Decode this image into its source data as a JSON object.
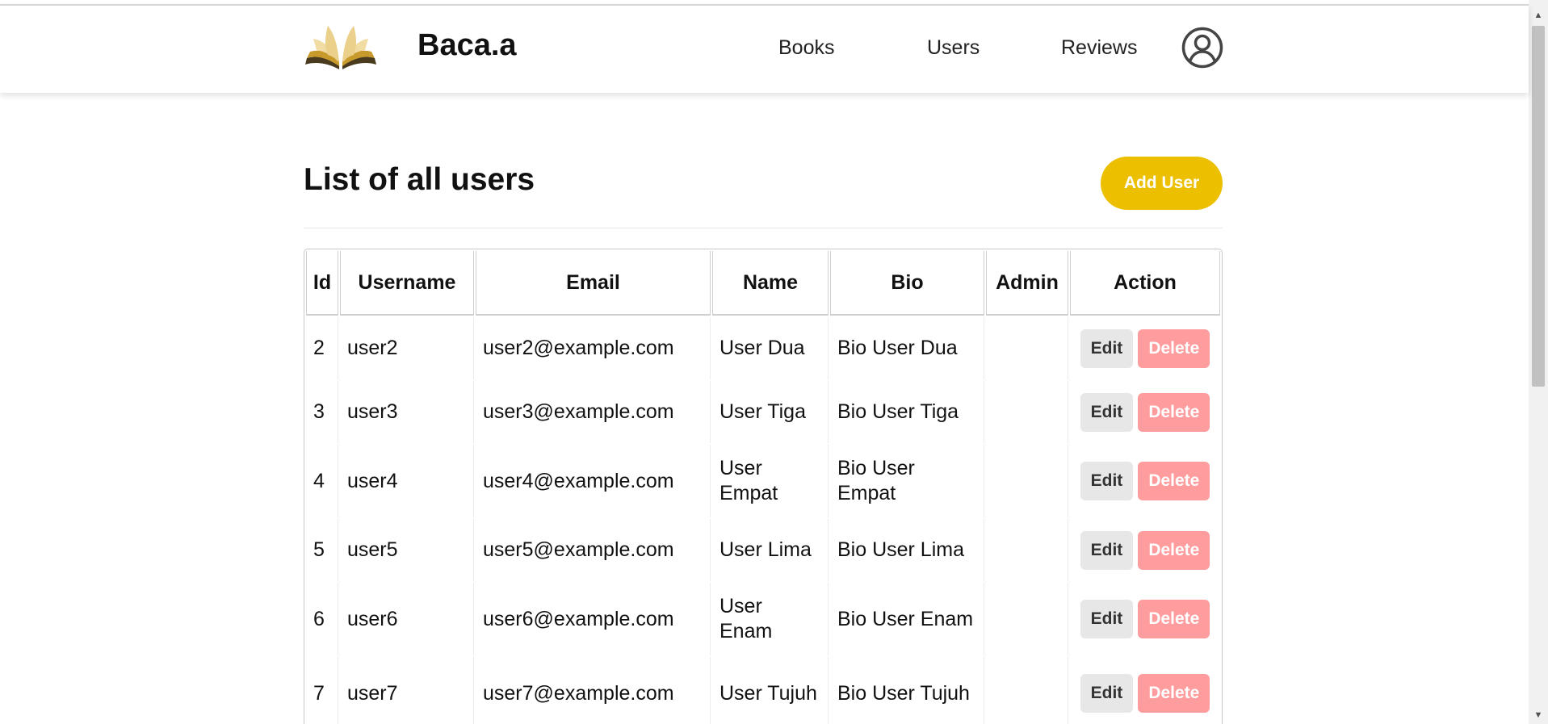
{
  "colors": {
    "accent": "#ecbf00",
    "delete_button": "#ff9c9e",
    "edit_button": "#e7e7e7"
  },
  "navbar": {
    "logo_icon": "open-book-logo",
    "brand": "Baca.a",
    "links": [
      "Books",
      "Users",
      "Reviews"
    ],
    "profile_icon": "user-circle-icon"
  },
  "main": {
    "title": "List of all users",
    "add_user_label": "Add User"
  },
  "table": {
    "headers": [
      "Id",
      "Username",
      "Email",
      "Name",
      "Bio",
      "Admin",
      "Action"
    ],
    "edit_label": "Edit",
    "delete_label": "Delete",
    "rows": [
      {
        "id": "2",
        "username": "user2",
        "email": "user2@example.com",
        "name": "User Dua",
        "bio": "Bio User Dua",
        "admin": ""
      },
      {
        "id": "3",
        "username": "user3",
        "email": "user3@example.com",
        "name": "User Tiga",
        "bio": "Bio User Tiga",
        "admin": ""
      },
      {
        "id": "4",
        "username": "user4",
        "email": "user4@example.com",
        "name": "User Empat",
        "bio": "Bio User Empat",
        "admin": ""
      },
      {
        "id": "5",
        "username": "user5",
        "email": "user5@example.com",
        "name": "User Lima",
        "bio": "Bio User Lima",
        "admin": ""
      },
      {
        "id": "6",
        "username": "user6",
        "email": "user6@example.com",
        "name": "User Enam",
        "bio": "Bio User Enam",
        "admin": ""
      },
      {
        "id": "7",
        "username": "user7",
        "email": "user7@example.com",
        "name": "User Tujuh",
        "bio": "Bio User Tujuh",
        "admin": ""
      }
    ]
  }
}
